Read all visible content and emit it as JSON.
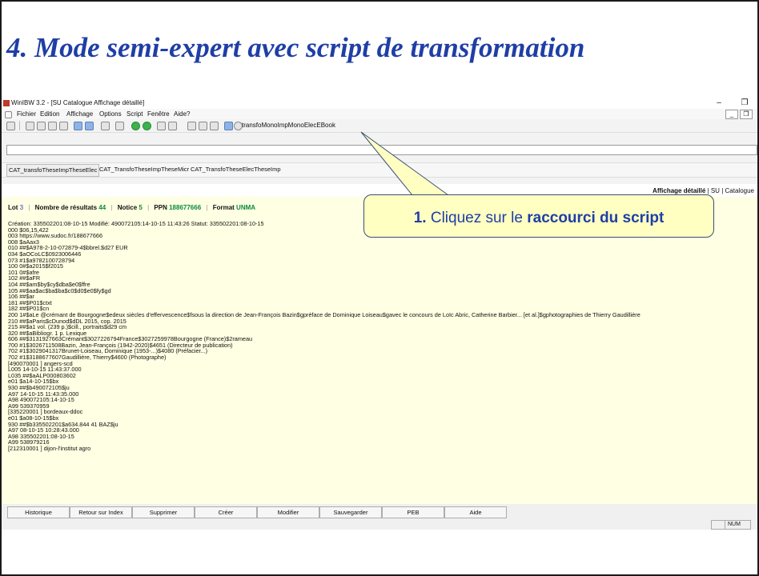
{
  "slide": {
    "title": "4. Mode semi-expert avec script de transformation"
  },
  "window": {
    "title": "WinIBW 3.2 - [SU Catalogue Affichage détaillé]",
    "controls": {
      "minimize": "–",
      "maximize": "❐",
      "mdi_minimize": "_",
      "mdi_restore": "❐"
    }
  },
  "menu": {
    "items": [
      "Fichier",
      "Edition",
      "Affichage",
      "Options",
      "Script",
      "Fenêtre",
      "Aide?"
    ]
  },
  "toolbar": {
    "script_name": "transfoMonoImpMonoElecEBook"
  },
  "scripts": {
    "buttons": [
      "CAT_transfoTheseImpTheseElec",
      "CAT_TransfoTheseImpTheseMicr",
      "CAT_TransfoTheseElecTheseImp"
    ]
  },
  "view_header": {
    "mode": "Affichage détaillé",
    "sep": "|",
    "db": "SU",
    "context": "Catalogue"
  },
  "record": {
    "lot_label": "Lot",
    "lot_value": "3",
    "results_label": "Nombre de résultats",
    "results_value": "44",
    "notice_label": "Notice",
    "notice_value": "5",
    "ppn_label": "PPN",
    "ppn_value": "188677666",
    "format_label": "Format",
    "format_value": "UNMA",
    "lines": [
      "Création: 335502201:08-10-15 Modifié: 490072105:14-10-15 11:43:26 Statut: 335502201:08-10-15",
      "000 $06,15,422",
      "003 https://www.sudoc.fr/188677666",
      "008 $aAax3",
      "010 ##$A978-2-10-072879-4$bbrel.$d27 EUR",
      "034 $aOCoLC$0923006446",
      "073 #1$a9782100728794",
      "100 0#$a2015$f2015",
      "101 0#$afre",
      "102 ##$aFR",
      "104 ##$am$by$cy$dba$e0$ffre",
      "105 ##$aa$ac$ba$ba$c0$d0$e0$fy$gd",
      "106 ##$ar",
      "181 ##$P01$ctxt",
      "182 ##$P01$cn",
      "200 1#$aLe @crémant de Bourgogne$edeux siècles d'effervescence$fsous la direction de Jean-François Bazin$gpréface de Dominique Loiseau$gavec le concours de Loïc Abric, Catherine Barbier... [et al.]$gphotographies de Thierry Gaudillière",
      "210 ##$aParis$cDunod$dDL 2015, cop. 2015",
      "215 ##$a1 vol. (239 p.)$cill., portraits$d29 cm",
      "320 ##$aBibliogr. 1 p. Lexique",
      "606 ##$3131927663Crémant$3027226794France$3027259978Bourgogne (France)$2rameau",
      "700 #1$3026711508Bazin, Jean-François (1942-2020)$4651 (Directeur de publication)",
      "702 #1$3029041317Brunet-Loiseau, Dominique (1953-...)$4080 (Préfacier...)",
      "702 #1$3188677607Gaudillière, Thierry$4600 (Photographe)",
      "[490070001 ] angers-scd",
      "L005 14-10-15 11:43:37.000",
      "L035 ##$aALP000803602",
      "e01 $a14-10-15$bx",
      "930 ##$b490072105$ju",
      "A97 14-10-15 11:43:35.000",
      "A98 490072105:14-10-15",
      "A99 539370959",
      "[335220001 ] bordeaux-ddoc",
      "e01 $a08-10-15$bx",
      "930 ##$b335502201$a634.844 41 BAZ$ju",
      "A97 08-10-15 10:28:43.000",
      "A98 335502201:08-10-15",
      "A99 538979216",
      "[212310001 ] dijon-l'institut agro"
    ]
  },
  "buttons": [
    "Historique",
    "Retour sur Index",
    "Supprimer",
    "Créer",
    "Modifier",
    "Sauvegarder",
    "PEB",
    "Aide"
  ],
  "status": {
    "num": "NUM"
  },
  "callout": {
    "number": "1.",
    "text_prefix": "Cliquez sur le",
    "text_bold": "raccourci du script"
  },
  "colors": {
    "title": "#1f3ea6",
    "record_bg": "#ffffe3",
    "callout_bg": "#ffffc2",
    "link_blue": "#2340c8",
    "count_green": "#0a8a3a"
  }
}
